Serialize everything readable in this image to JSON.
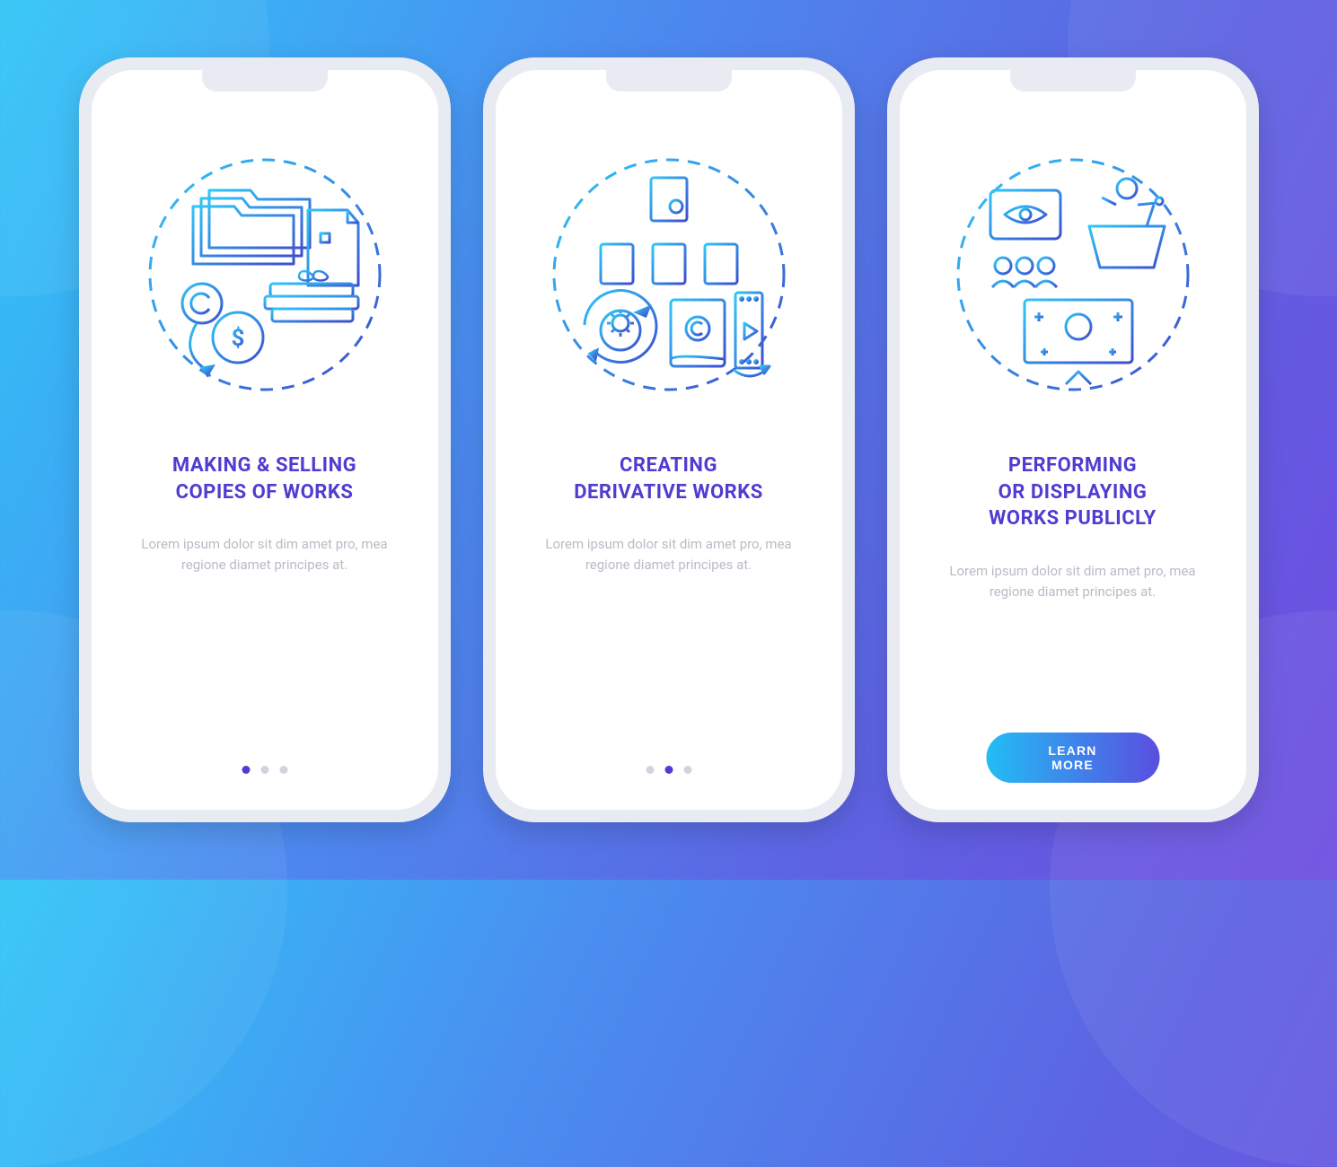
{
  "screens": [
    {
      "titleLine1": "MAKING & SELLING",
      "titleLine2": "COPIES OF WORKS",
      "titleLine3": "",
      "body": "Lorem ipsum dolor sit dim amet pro, mea regione diamet principes at.",
      "icon": "copies-icon",
      "pager_active": 0,
      "has_button": false
    },
    {
      "titleLine1": "CREATING",
      "titleLine2": "DERIVATIVE WORKS",
      "titleLine3": "",
      "body": "Lorem ipsum dolor sit dim amet pro, mea regione diamet principes at.",
      "icon": "derivative-icon",
      "pager_active": 1,
      "has_button": false
    },
    {
      "titleLine1": "PERFORMING",
      "titleLine2": "OR DISPLAYING",
      "titleLine3": "WORKS PUBLICLY",
      "body": "Lorem ipsum dolor sit dim amet pro, mea regione diamet principes at.",
      "icon": "display-icon",
      "pager_active": 2,
      "has_button": true
    }
  ],
  "cta_label": "LEARN MORE",
  "colors": {
    "icon_stroke_a": "#2fc6f7",
    "icon_stroke_b": "#3d4ed1"
  }
}
